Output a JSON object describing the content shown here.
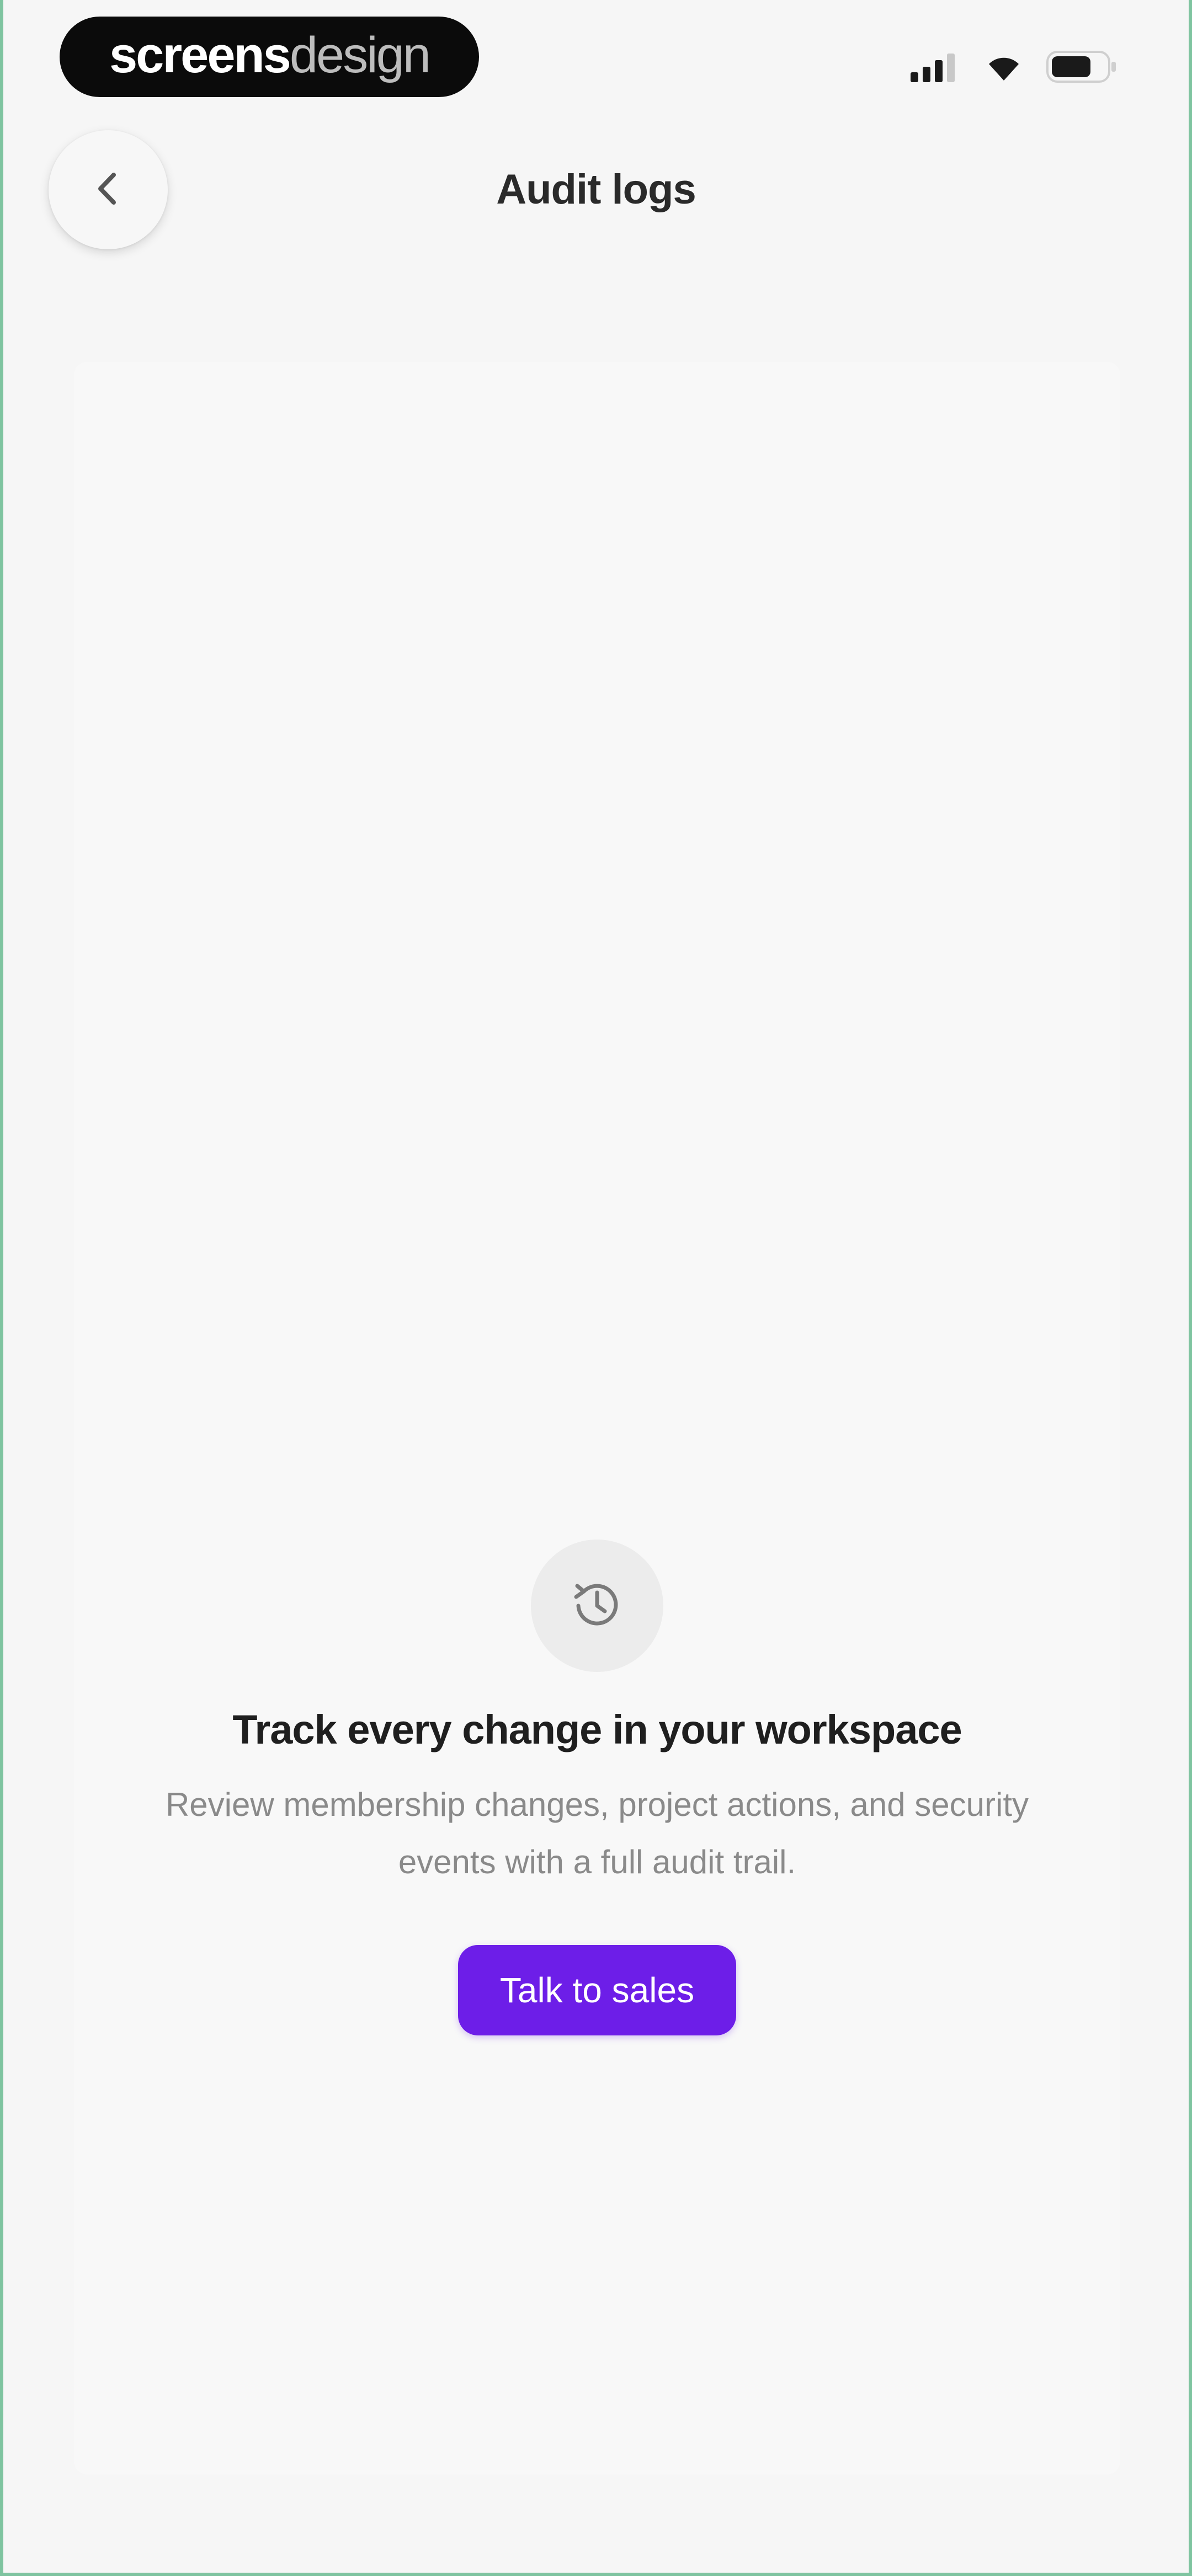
{
  "status_bar": {
    "brand_bold": "screens",
    "brand_light": "design"
  },
  "nav": {
    "title": "Audit logs",
    "back_icon": "chevron-left-icon"
  },
  "empty_state": {
    "icon": "history-icon",
    "heading": "Track every change in your workspace",
    "description": "Review membership changes, project actions, and security events with a full audit trail.",
    "cta_label": "Talk to sales"
  },
  "colors": {
    "accent": "#6d1ee8",
    "background": "#f6f6f6"
  }
}
